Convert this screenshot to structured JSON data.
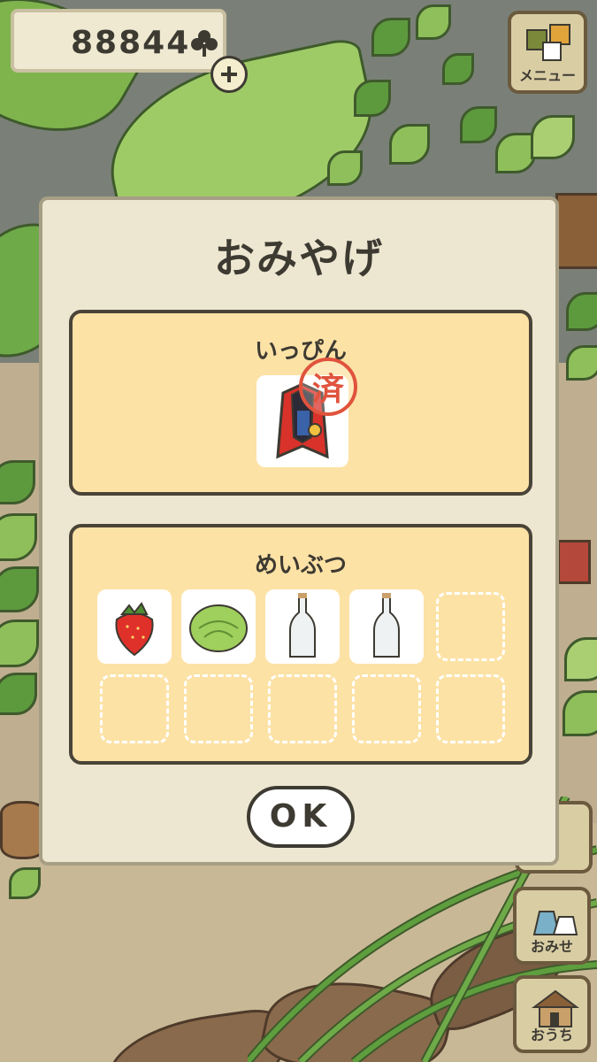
{
  "hud": {
    "clover_count": "88844",
    "clover_icon": "clover-icon",
    "plus_icon": "plus-icon"
  },
  "side_menu": {
    "menu_label": "メニュー",
    "shop_label": "おみせ",
    "home_label": "おうち"
  },
  "dialog": {
    "title": "おみやげ",
    "special": {
      "title": "いっぴん",
      "item_icon": "red-cape-charm-icon",
      "stamp_text": "済"
    },
    "regional": {
      "title": "めいぶつ",
      "items": [
        {
          "icon": "strawberry-icon"
        },
        {
          "icon": "cabbage-icon"
        },
        {
          "icon": "glass-bottle-icon"
        },
        {
          "icon": "glass-bottle-icon"
        }
      ],
      "empty_slots": 6
    },
    "ok_label": "OK"
  }
}
